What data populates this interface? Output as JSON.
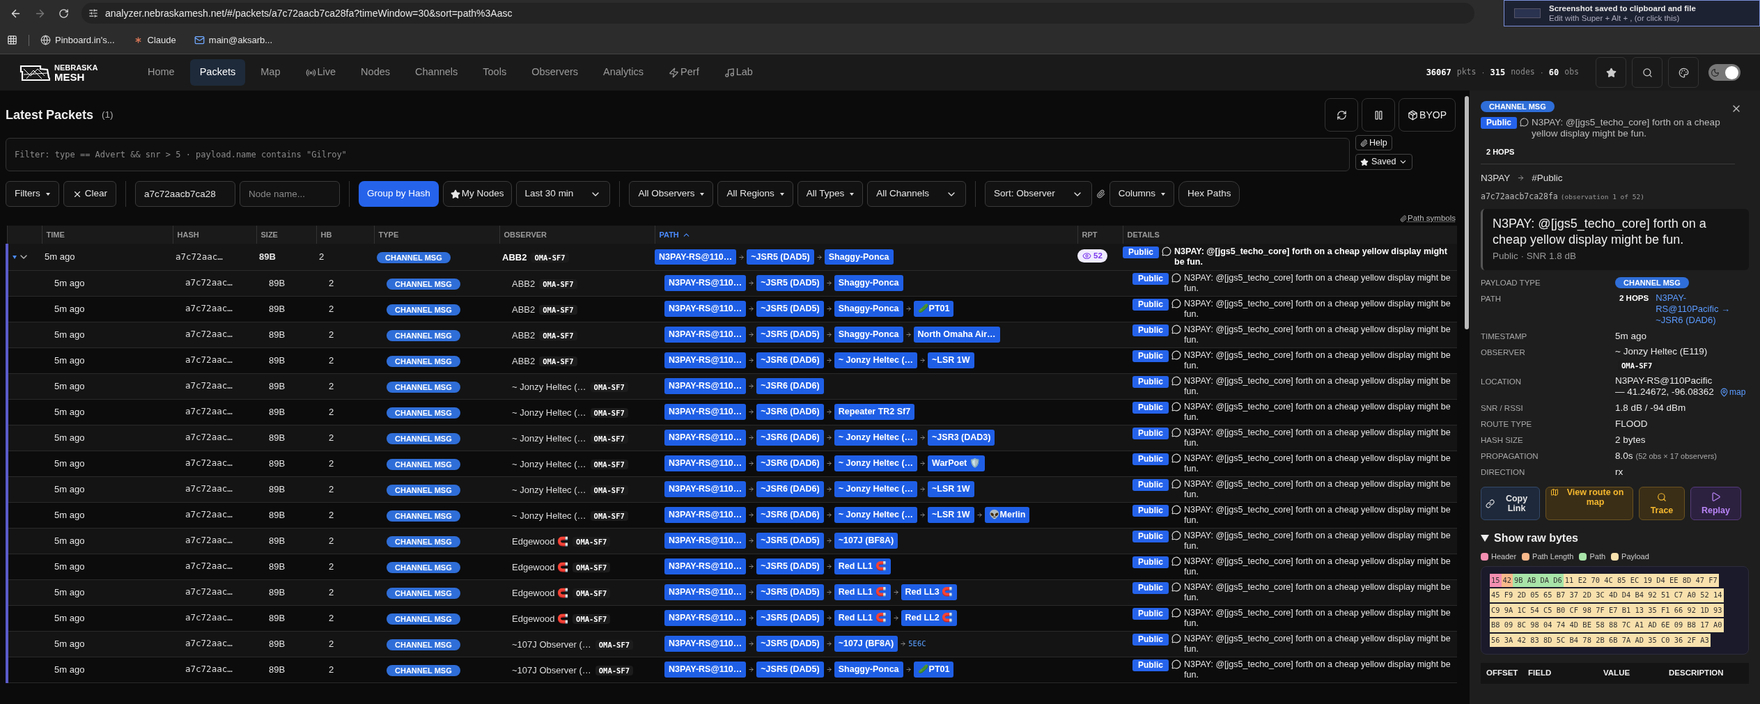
{
  "browser": {
    "url": "analyzer.nebraskamesh.net/#/packets/a7c72aacb7ca28fa?timeWindow=30&sort=path%3Aasc",
    "bookmarks": [
      {
        "label": "Pinboard.in's...",
        "kind": "globe"
      },
      {
        "label": "Claude",
        "kind": "claude"
      },
      {
        "label": "main@aksarb...",
        "kind": "mail"
      }
    ]
  },
  "notification": {
    "title": "Screenshot saved to clipboard and file",
    "body": "Edit with Super + Alt + , (or click this)"
  },
  "nav": {
    "logo": [
      "NEBRASKA",
      "MESH"
    ],
    "items": [
      {
        "label": "Home",
        "kind": "plain",
        "selected": false
      },
      {
        "label": "Packets",
        "kind": "plain",
        "selected": true
      },
      {
        "label": "Map",
        "kind": "plain",
        "selected": false
      },
      {
        "label": "Live",
        "kind": "radio",
        "selected": false
      },
      {
        "label": "Nodes",
        "kind": "plain",
        "selected": false
      },
      {
        "label": "Channels",
        "kind": "plain",
        "selected": false
      },
      {
        "label": "Tools",
        "kind": "plain",
        "selected": false
      },
      {
        "label": "Observers",
        "kind": "plain",
        "selected": false
      },
      {
        "label": "Analytics",
        "kind": "plain",
        "selected": false
      },
      {
        "label": "Perf",
        "kind": "bolt",
        "selected": false
      },
      {
        "label": "Lab",
        "kind": "note",
        "selected": false
      }
    ]
  },
  "stats": [
    {
      "value": "36067",
      "unit": "pkts",
      "sep": "·"
    },
    {
      "value": "315",
      "unit": "nodes",
      "sep": "·"
    },
    {
      "value": "60",
      "unit": "obs"
    }
  ],
  "theme_toggle": {
    "on": true
  },
  "page": {
    "title": "Latest Packets",
    "count": "(1)",
    "byop": "BYOP"
  },
  "filter": {
    "placeholder": "Filter: type == Advert && snr > 5 · payload.name contains \"Gilroy\"",
    "help": "Help",
    "saved": "Saved"
  },
  "toolbar": [
    [
      {
        "kind": "menu",
        "label": "Filters"
      },
      {
        "kind": "clear",
        "label": "Clear"
      }
    ],
    [
      {
        "kind": "input",
        "value": "a7c72aacb7ca28"
      },
      {
        "kind": "input",
        "placeholder": "Node name..."
      }
    ],
    [
      {
        "kind": "toggle",
        "label": "Group by Hash",
        "selected": true
      },
      {
        "kind": "star",
        "label": "My Nodes",
        "selected": false
      },
      {
        "kind": "select",
        "label": "Last 30 min"
      }
    ],
    [
      {
        "kind": "menu",
        "label": "All Observers"
      },
      {
        "kind": "menu",
        "label": "All Regions"
      },
      {
        "kind": "menu",
        "label": "All Types"
      },
      {
        "kind": "select",
        "label": "All Channels"
      }
    ],
    [
      {
        "kind": "select",
        "label": "Sort: Observer"
      },
      {
        "kind": "clip"
      },
      {
        "kind": "menu",
        "label": "Columns"
      },
      {
        "kind": "button",
        "label": "Hex Paths"
      }
    ]
  ],
  "path_symbols": "Path symbols",
  "table": {
    "columns": [
      {
        "label": "TIME",
        "sorted": false
      },
      {
        "label": "HASH",
        "sorted": false
      },
      {
        "label": "SIZE",
        "sorted": false
      },
      {
        "label": "HB",
        "sorted": false
      },
      {
        "label": "TYPE",
        "sorted": false
      },
      {
        "label": "OBSERVER",
        "sorted": false
      },
      {
        "label": "PATH",
        "sorted": true
      },
      {
        "label": "RPT",
        "sorted": false
      },
      {
        "label": "DETAILS",
        "sorted": false
      }
    ],
    "group": {
      "expanded": true,
      "time": "5m ago",
      "hash": "a7c72aac…",
      "size": "89B",
      "hb": "2",
      "type": "CHANNEL MSG",
      "observer": "ABB2",
      "observer_tag": "OMA-SF7",
      "path": [
        "N3PAY-RS@110…",
        "~JSR5 (DAD5)",
        "Shaggy-Ponca"
      ],
      "rpt": "52",
      "channel": "Public",
      "text": "N3PAY: @[jgs5_techo_core] forth on a cheap yellow display might be fun."
    },
    "rows": [
      {
        "time": "5m ago",
        "hash": "a7c72aac…",
        "size": "89B",
        "hb": "2",
        "type": "CHANNEL MSG",
        "observer": "ABB2",
        "observer_tag": "OMA-SF7",
        "path": [
          "N3PAY-RS@110…",
          "~JSR5 (DAD5)",
          "Shaggy-Ponca"
        ],
        "channel": "Public",
        "text": "N3PAY: @[jgs5_techo_core] forth on a cheap yellow display might be fun."
      },
      {
        "time": "5m ago",
        "hash": "a7c72aac…",
        "size": "89B",
        "hb": "2",
        "type": "CHANNEL MSG",
        "observer": "ABB2",
        "observer_tag": "OMA-SF7",
        "path": [
          "N3PAY-RS@110…",
          "~JSR5 (DAD5)",
          "Shaggy-Ponca",
          "🥒PT01"
        ],
        "channel": "Public",
        "text": "N3PAY: @[jgs5_techo_core] forth on a cheap yellow display might be fun."
      },
      {
        "time": "5m ago",
        "hash": "a7c72aac…",
        "size": "89B",
        "hb": "2",
        "type": "CHANNEL MSG",
        "observer": "ABB2",
        "observer_tag": "OMA-SF7",
        "path": [
          "N3PAY-RS@110…",
          "~JSR5 (DAD5)",
          "Shaggy-Ponca",
          "North Omaha Air…"
        ],
        "channel": "Public",
        "text": "N3PAY: @[jgs5_techo_core] forth on a cheap yellow display might be fun."
      },
      {
        "time": "5m ago",
        "hash": "a7c72aac…",
        "size": "89B",
        "hb": "2",
        "type": "CHANNEL MSG",
        "observer": "ABB2",
        "observer_tag": "OMA-SF7",
        "path": [
          "N3PAY-RS@110…",
          "~JSR6 (DAD6)",
          "~ Jonzy Heltec (…",
          "~LSR 1W"
        ],
        "channel": "Public",
        "text": "N3PAY: @[jgs5_techo_core] forth on a cheap yellow display might be fun."
      },
      {
        "time": "5m ago",
        "hash": "a7c72aac…",
        "size": "89B",
        "hb": "2",
        "type": "CHANNEL MSG",
        "observer": "~ Jonzy Heltec (…",
        "observer_tag": "OMA-SF7",
        "path": [
          "N3PAY-RS@110…",
          "~JSR6 (DAD6)"
        ],
        "channel": "Public",
        "text": "N3PAY: @[jgs5_techo_core] forth on a cheap yellow display might be fun."
      },
      {
        "time": "5m ago",
        "hash": "a7c72aac…",
        "size": "89B",
        "hb": "2",
        "type": "CHANNEL MSG",
        "observer": "~ Jonzy Heltec (…",
        "observer_tag": "OMA-SF7",
        "path": [
          "N3PAY-RS@110…",
          "~JSR6 (DAD6)",
          "Repeater TR2 Sf7"
        ],
        "channel": "Public",
        "text": "N3PAY: @[jgs5_techo_core] forth on a cheap yellow display might be fun."
      },
      {
        "time": "5m ago",
        "hash": "a7c72aac…",
        "size": "89B",
        "hb": "2",
        "type": "CHANNEL MSG",
        "observer": "~ Jonzy Heltec (…",
        "observer_tag": "OMA-SF7",
        "path": [
          "N3PAY-RS@110…",
          "~JSR6 (DAD6)",
          "~ Jonzy Heltec (…",
          "~JSR3 (DAD3)"
        ],
        "channel": "Public",
        "text": "N3PAY: @[jgs5_techo_core] forth on a cheap yellow display might be fun."
      },
      {
        "time": "5m ago",
        "hash": "a7c72aac…",
        "size": "89B",
        "hb": "2",
        "type": "CHANNEL MSG",
        "observer": "~ Jonzy Heltec (…",
        "observer_tag": "OMA-SF7",
        "path": [
          "N3PAY-RS@110…",
          "~JSR6 (DAD6)",
          "~ Jonzy Heltec (…",
          "WarPoet 🛡️"
        ],
        "channel": "Public",
        "text": "N3PAY: @[jgs5_techo_core] forth on a cheap yellow display might be fun."
      },
      {
        "time": "5m ago",
        "hash": "a7c72aac…",
        "size": "89B",
        "hb": "2",
        "type": "CHANNEL MSG",
        "observer": "~ Jonzy Heltec (…",
        "observer_tag": "OMA-SF7",
        "path": [
          "N3PAY-RS@110…",
          "~JSR6 (DAD6)",
          "~ Jonzy Heltec (…",
          "~LSR 1W"
        ],
        "channel": "Public",
        "text": "N3PAY: @[jgs5_techo_core] forth on a cheap yellow display might be fun."
      },
      {
        "time": "5m ago",
        "hash": "a7c72aac…",
        "size": "89B",
        "hb": "2",
        "type": "CHANNEL MSG",
        "observer": "~ Jonzy Heltec (…",
        "observer_tag": "OMA-SF7",
        "path": [
          "N3PAY-RS@110…",
          "~JSR6 (DAD6)",
          "~ Jonzy Heltec (…",
          "~LSR 1W",
          "👽Merlin"
        ],
        "channel": "Public",
        "text": "N3PAY: @[jgs5_techo_core] forth on a cheap yellow display might be fun."
      },
      {
        "time": "5m ago",
        "hash": "a7c72aac…",
        "size": "89B",
        "hb": "2",
        "type": "CHANNEL MSG",
        "observer": "Edgewood 🧲",
        "observer_tag": "OMA-SF7",
        "path": [
          "N3PAY-RS@110…",
          "~JSR5 (DAD5)",
          "~107J (BF8A)"
        ],
        "channel": "Public",
        "text": "N3PAY: @[jgs5_techo_core] forth on a cheap yellow display might be fun."
      },
      {
        "time": "5m ago",
        "hash": "a7c72aac…",
        "size": "89B",
        "hb": "2",
        "type": "CHANNEL MSG",
        "observer": "Edgewood 🧲",
        "observer_tag": "OMA-SF7",
        "path": [
          "N3PAY-RS@110…",
          "~JSR5 (DAD5)",
          "Red LL1 🧲"
        ],
        "channel": "Public",
        "text": "N3PAY: @[jgs5_techo_core] forth on a cheap yellow display might be fun."
      },
      {
        "time": "5m ago",
        "hash": "a7c72aac…",
        "size": "89B",
        "hb": "2",
        "type": "CHANNEL MSG",
        "observer": "Edgewood 🧲",
        "observer_tag": "OMA-SF7",
        "path": [
          "N3PAY-RS@110…",
          "~JSR5 (DAD5)",
          "Red LL1 🧲",
          "Red LL3 🧲"
        ],
        "channel": "Public",
        "text": "N3PAY: @[jgs5_techo_core] forth on a cheap yellow display might be fun."
      },
      {
        "time": "5m ago",
        "hash": "a7c72aac…",
        "size": "89B",
        "hb": "2",
        "type": "CHANNEL MSG",
        "observer": "Edgewood 🧲",
        "observer_tag": "OMA-SF7",
        "path": [
          "N3PAY-RS@110…",
          "~JSR5 (DAD5)",
          "Red LL1 🧲",
          "Red LL2 🧲"
        ],
        "channel": "Public",
        "text": "N3PAY: @[jgs5_techo_core] forth on a cheap yellow display might be fun."
      },
      {
        "time": "5m ago",
        "hash": "a7c72aac…",
        "size": "89B",
        "hb": "2",
        "type": "CHANNEL MSG",
        "observer": "~107J Observer (…",
        "observer_tag": "OMA-SF7",
        "path": [
          "N3PAY-RS@110…",
          "~JSR5 (DAD5)",
          "~107J (BF8A)"
        ],
        "path_extra": "5E6C",
        "channel": "Public",
        "text": "N3PAY: @[jgs5_techo_core] forth on a cheap yellow display might be fun."
      },
      {
        "time": "5m ago",
        "hash": "a7c72aac…",
        "size": "89B",
        "hb": "2",
        "type": "CHANNEL MSG",
        "observer": "~107J Observer (…",
        "observer_tag": "OMA-SF7",
        "path": [
          "N3PAY-RS@110…",
          "~JSR5 (DAD5)",
          "Shaggy-Ponca",
          "🥒PT01"
        ],
        "channel": "Public",
        "text": "N3PAY: @[jgs5_techo_core] forth on a cheap yellow display might be fun."
      }
    ]
  },
  "detail_panel": {
    "type_badge": "CHANNEL MSG",
    "channel": "Public",
    "message": "N3PAY: @[jgs5_techo_core] forth on a cheap yellow display might be fun.",
    "hops": "2 HOPS",
    "route": {
      "from": "N3PAY",
      "to": "#Public"
    },
    "hash": "a7c72aacb7ca28fa",
    "observation": "(observation 1 of 52)",
    "quote": {
      "text": "N3PAY: @[jgs5_techo_core] forth on a cheap yellow display might be fun.",
      "meta": "Public · SNR 1.8 dB"
    },
    "fields": [
      {
        "kind": "badge",
        "label": "PAYLOAD TYPE",
        "value": "CHANNEL MSG"
      },
      {
        "kind": "path",
        "label": "PATH",
        "hops": "2 HOPS",
        "value": "N3PAY-RS@110Pacific → ~JSR6 (DAD6)"
      },
      {
        "kind": "text",
        "label": "TIMESTAMP",
        "value": "5m ago"
      },
      {
        "kind": "observer",
        "label": "OBSERVER",
        "value": "~ Jonzy Heltec (E119)",
        "tag": "OMA-SF7"
      },
      {
        "kind": "location",
        "label": "LOCATION",
        "value": "N3PAY-RS@110Pacific — 41.24672, -96.08362",
        "link": "map"
      },
      {
        "kind": "text",
        "label": "SNR / RSSI",
        "value": "1.8 dB / -94 dBm"
      },
      {
        "kind": "text",
        "label": "ROUTE TYPE",
        "value": "FLOOD"
      },
      {
        "kind": "text",
        "label": "HASH SIZE",
        "value": "2 bytes"
      },
      {
        "kind": "propagation",
        "label": "PROPAGATION",
        "value": "8.0s",
        "note": "(52 obs × 17 observers)"
      },
      {
        "kind": "text",
        "label": "DIRECTION",
        "value": "rx"
      }
    ],
    "actions": [
      {
        "kind": "copy",
        "label": "Copy Link"
      },
      {
        "kind": "map",
        "label": "View route on map"
      },
      {
        "kind": "trace",
        "label": "Trace"
      },
      {
        "kind": "replay",
        "label": "Replay"
      }
    ],
    "raw_bytes": {
      "title": "Show raw bytes",
      "expanded": true,
      "legend": [
        {
          "kind": "header",
          "label": "Header",
          "color": "#f48fb1"
        },
        {
          "kind": "path_length",
          "label": "Path Length",
          "color": "#f9b98a"
        },
        {
          "kind": "path",
          "label": "Path",
          "color": "#a8e4a8"
        },
        {
          "kind": "payload",
          "label": "Payload",
          "color": "#f9e1ad"
        }
      ],
      "lines": [
        [
          {
            "kind": "header",
            "bytes": "15"
          },
          {
            "kind": "path_length",
            "bytes": "42"
          },
          {
            "kind": "path",
            "bytes": "9B AB DA D6"
          },
          {
            "kind": "payload",
            "bytes": "11 E2 70 4C 85 EC 19 D4 EE 8D 47 F7"
          }
        ],
        [
          {
            "kind": "payload",
            "bytes": "45 F9 2D 05 65 B7 37 2D 3C 4D D4 B4 92 51 C7 A0 52 14"
          }
        ],
        [
          {
            "kind": "payload",
            "bytes": "C9 9A 1C 54 C5 B0 CF 98 7F E7 B1 13 35 F1 66 92 1D 93"
          }
        ],
        [
          {
            "kind": "payload",
            "bytes": "B8 09 8C 98 04 74 4D BE 58 88 7C A1 AD 6E 09 B8 17 A0"
          }
        ],
        [
          {
            "kind": "payload",
            "bytes": "56 3A 42 83 8D 5C B4 78 2B 6B 7A AD 35 C0 36 2F A3"
          }
        ]
      ]
    },
    "fields_table": {
      "columns": [
        "OFFSET",
        "FIELD",
        "VALUE",
        "DESCRIPTION"
      ]
    }
  }
}
